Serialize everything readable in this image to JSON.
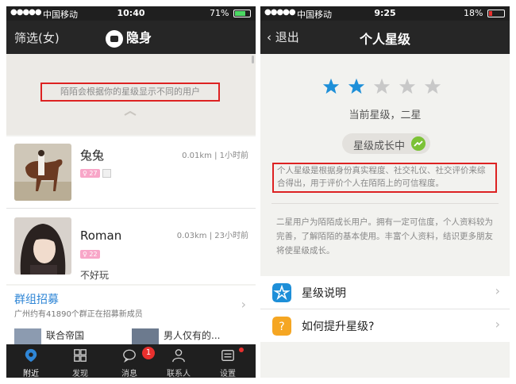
{
  "left": {
    "status": {
      "signal": "●●●●●",
      "carrier": "中国移动",
      "time": "10:40",
      "battery": "71%",
      "battery_level": 0.71
    },
    "nav": {
      "filter": "筛选(女)",
      "title": "隐身"
    },
    "hint": "陌陌会根据你的星级显示不同的用户",
    "users": [
      {
        "name": "兔兔",
        "meta": "0.01km | 1小时前",
        "age": "27",
        "status": ""
      },
      {
        "name": "Roman",
        "meta": "0.03km | 23小时前",
        "age": "22",
        "status": "不好玩"
      }
    ],
    "group": {
      "title": "群组招募",
      "subtitle": "广州约有41890个群正在招募新成员"
    },
    "group_items": [
      {
        "text": "联合帝国"
      },
      {
        "text": "男人仅有的..."
      }
    ],
    "tabs": [
      {
        "label": "附近",
        "icon": "location-icon"
      },
      {
        "label": "发现",
        "icon": "discover-grid-icon"
      },
      {
        "label": "消息",
        "icon": "message-icon"
      },
      {
        "label": "联系人",
        "icon": "contacts-icon"
      },
      {
        "label": "设置",
        "icon": "settings-icon"
      }
    ],
    "message_badge": "1",
    "colors": {
      "accent": "#2f86d6",
      "badge_red": "#e8302e",
      "highlight": "#dd2222"
    }
  },
  "right": {
    "status": {
      "signal": "●●●●●",
      "carrier": "中国移动",
      "time": "9:25",
      "battery": "18%",
      "battery_level": 0.18
    },
    "nav": {
      "back": "退出",
      "title": "个人星级"
    },
    "stars": {
      "filled": 2,
      "total": 5
    },
    "level_text": "当前星级，二星",
    "growth_pill": "星级成长中",
    "definition": "个人星级是根据身份真实程度、社交礼仪、社交评价来综合得出，用于评价个人在陌陌上的可信程度。",
    "explanation": "二星用户为陌陌成长用户。拥有一定可信度，个人资料较为完善，了解陌陌的基本使用。丰富个人资料，结识更多朋友将使星级成长。",
    "menu": [
      {
        "label": "星级说明",
        "icon": "star-icon"
      },
      {
        "label": "如何提升星级?",
        "icon": "question-icon"
      }
    ],
    "colors": {
      "star_blue": "#1e8fd8",
      "star_gray": "#c8c8c8",
      "growth_green": "#7cc236",
      "help_orange": "#f5a623"
    }
  }
}
